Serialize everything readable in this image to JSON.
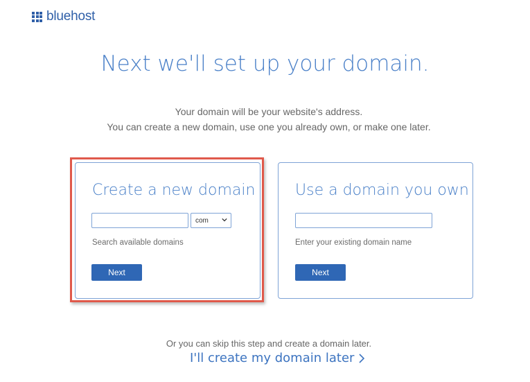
{
  "brand": {
    "name": "bluehost"
  },
  "page": {
    "title": "Next we'll set up your domain.",
    "subtitle_line1": "Your domain will be your website's address.",
    "subtitle_line2": "You can create a new domain, use one you already own, or make one later."
  },
  "create_domain": {
    "heading": "Create a new domain",
    "input_value": "",
    "tld_selected": "com",
    "helper": "Search available domains",
    "button_label": "Next"
  },
  "own_domain": {
    "heading": "Use a domain you own",
    "input_value": "",
    "helper": "Enter your existing domain name",
    "button_label": "Next"
  },
  "footer": {
    "skip_text": "Or you can skip this step and create a domain later.",
    "later_link": "I'll create my domain later"
  },
  "colors": {
    "brand_blue": "#2f5fa8",
    "title_blue": "#4a80c8",
    "button_blue": "#2f67b5",
    "highlight_red": "#e0594b"
  },
  "icons": [
    "logo-grid-icon",
    "chevron-down-icon",
    "chevron-right-icon"
  ]
}
